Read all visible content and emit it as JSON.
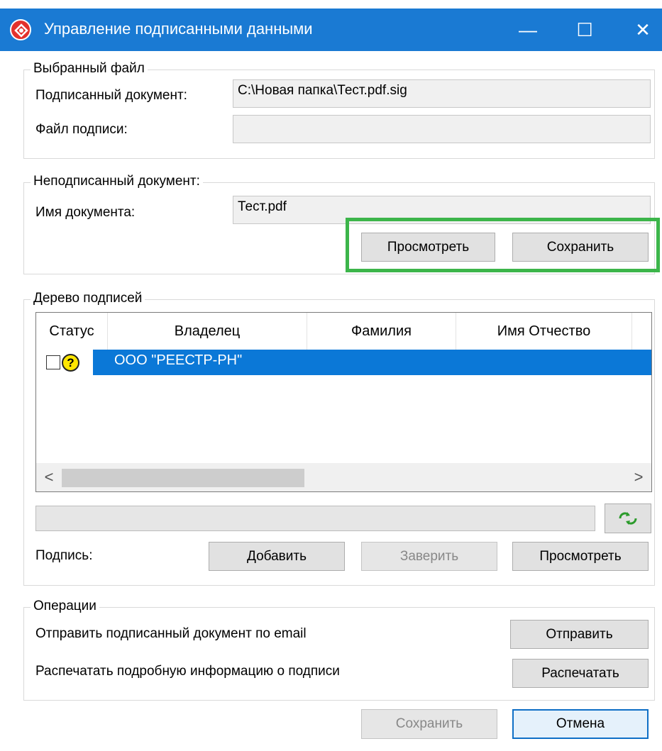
{
  "window": {
    "title": "Управление подписанными данными",
    "minimize_glyph": "—",
    "maximize_glyph": "☐",
    "close_glyph": "✕"
  },
  "selected_file": {
    "group_label": "Выбранный файл",
    "signed_doc_label": "Подписанный документ:",
    "signed_doc_value": "C:\\Новая папка\\Тест.pdf.sig",
    "signature_file_label": "Файл подписи:",
    "signature_file_value": ""
  },
  "unsigned_doc": {
    "group_label": "Неподписанный документ:",
    "doc_name_label": "Имя документа:",
    "doc_name_value": "Тест.pdf",
    "view_button": "Просмотреть",
    "save_button": "Сохранить"
  },
  "signature_tree": {
    "group_label": "Дерево подписей",
    "columns": [
      "Статус",
      "Владелец",
      "Фамилия",
      "Имя Отчество"
    ],
    "rows": [
      {
        "owner": "ООО \"РЕЕСТР-РН\"",
        "status_icon": "question-icon",
        "checked": false
      }
    ],
    "scroll_left": "<",
    "scroll_right": ">"
  },
  "signature": {
    "label": "Подпись:",
    "add_button": "Добавить",
    "certify_button": "Заверить",
    "view_button": "Просмотреть"
  },
  "operations": {
    "group_label": "Операции",
    "email_text": "Отправить подписанный документ по email",
    "send_button": "Отправить",
    "print_text": "Распечатать подробную информацию о подписи",
    "print_button": "Распечатать"
  },
  "footer": {
    "save_button": "Сохранить",
    "cancel_button": "Отмена"
  },
  "colors": {
    "titlebar": "#1a7ad3",
    "highlight": "#3cb54a",
    "selection": "#0b78d7"
  }
}
